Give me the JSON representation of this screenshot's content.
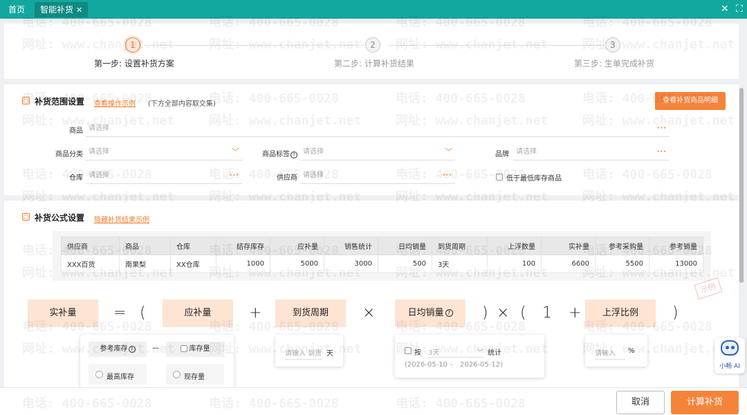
{
  "tabs": {
    "home": "首页",
    "active": "智能补货",
    "close": "✕"
  },
  "window_icons": {
    "close": "✕",
    "fullscreen": "⛶"
  },
  "watermark": {
    "phone": "电话: 400-665-0028",
    "site": "网址: www.chanjet.net"
  },
  "steps": [
    {
      "num": "1",
      "label": "第一步: 设置补货方案"
    },
    {
      "num": "2",
      "label": "第二步: 计算补货结果"
    },
    {
      "num": "3",
      "label": "第三步: 生单完成补货"
    }
  ],
  "range": {
    "title": "补货范围设置",
    "link": "查看操作示例",
    "note": "(下方全部内容取交集)",
    "detail_button": "查看补货商品明细",
    "fields": {
      "product": {
        "label": "商品",
        "placeholder": "请选择"
      },
      "category": {
        "label": "商品分类",
        "placeholder": "请选择"
      },
      "tag": {
        "label": "商品标签",
        "placeholder": "请选择"
      },
      "brand": {
        "label": "品牌",
        "placeholder": "请选择"
      },
      "warehouse": {
        "label": "仓库",
        "placeholder": "请选择"
      },
      "supplier": {
        "label": "供应商",
        "placeholder": "请选择"
      }
    },
    "low_stock_label": "低于最低库存商品"
  },
  "formula": {
    "title": "补货公式设置",
    "link": "隐藏补货结果示例",
    "table_headers": [
      "供应商",
      "商品",
      "仓库",
      "结存库存",
      "应补量",
      "销售统计",
      "日均销量",
      "到货周期",
      "上浮数量",
      "实补量",
      "参考采购量",
      "参考销量"
    ],
    "table_row": [
      "XXX百货",
      "南果梨",
      "XX仓库",
      "1000",
      "5000",
      "3000",
      "500",
      "3天",
      "100",
      "6600",
      "5500",
      "13000"
    ],
    "stamp": "示例",
    "boxes": {
      "actual": "实补量",
      "should": "应补量",
      "cycle": "到货周期",
      "daily": "日均销量",
      "float_ratio": "上浮比例"
    },
    "symbols": {
      "eq": "=",
      "lparen": "(",
      "plus": "+",
      "times": "×",
      "rparen": ")",
      "one": "1"
    },
    "should_drop": {
      "ref_stock": "参考库存",
      "minus": "—",
      "stock_qty": "库存量",
      "max_stock": "最高库存",
      "current_qty": "现存量"
    },
    "cycle_drop": {
      "placeholder": "请输入 到货",
      "unit": "天"
    },
    "daily_drop": {
      "by": "按",
      "days": "3天",
      "stat": "统计",
      "date_from": "(2026-05-10",
      "dash": "-",
      "date_to": "2026-05-12)"
    },
    "ratio_drop": {
      "placeholder": "请输入",
      "unit": "%"
    }
  },
  "buttons": {
    "cancel": "取消",
    "calculate": "计算补货"
  },
  "assistant": {
    "name": "小畅 AI"
  },
  "colors": {
    "accent": "#f5843a",
    "topbar": "#13a89e",
    "formula_box": "#fde4d3"
  }
}
